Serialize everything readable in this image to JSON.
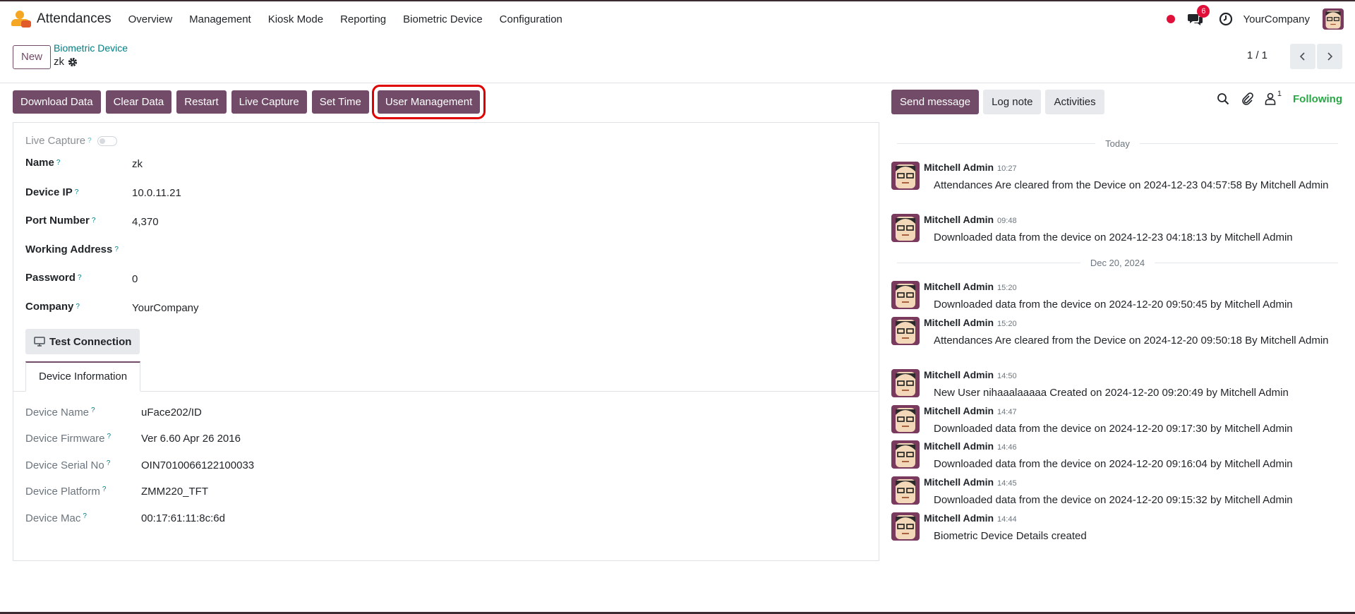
{
  "navbar": {
    "app_name": "Attendances",
    "menu": [
      "Overview",
      "Management",
      "Kiosk Mode",
      "Reporting",
      "Biometric Device",
      "Configuration"
    ],
    "chat_badge": "6",
    "company": "YourCompany"
  },
  "control_panel": {
    "new_label": "New",
    "breadcrumb": "Biometric Device",
    "record_name": "zk",
    "pager": "1 / 1"
  },
  "form_buttons": {
    "download": "Download Data",
    "clear": "Clear Data",
    "restart": "Restart",
    "live_capture": "Live Capture",
    "set_time": "Set Time",
    "user_management": "User Management"
  },
  "form": {
    "live_capture_label": "Live Capture",
    "live_capture_on": false,
    "fields": {
      "name": {
        "label": "Name",
        "value": "zk"
      },
      "device_ip": {
        "label": "Device IP",
        "value": "10.0.11.21"
      },
      "port": {
        "label": "Port Number",
        "value": "4,370"
      },
      "working_address": {
        "label": "Working Address",
        "value": ""
      },
      "password": {
        "label": "Password",
        "value": "0"
      },
      "company": {
        "label": "Company",
        "value": "YourCompany"
      }
    },
    "test_connection": "Test Connection",
    "tab_label": "Device Information",
    "info": {
      "device_name": {
        "label": "Device Name",
        "value": "uFace202/ID"
      },
      "firmware": {
        "label": "Device Firmware",
        "value": "Ver 6.60 Apr 26 2016"
      },
      "serial": {
        "label": "Device Serial No",
        "value": "OIN7010066122100033"
      },
      "platform": {
        "label": "Device Platform",
        "value": "ZMM220_TFT"
      },
      "mac": {
        "label": "Device Mac",
        "value": "00:17:61:11:8c:6d"
      }
    }
  },
  "chatter": {
    "send_message": "Send message",
    "log_note": "Log note",
    "activities": "Activities",
    "followers_count": "1",
    "following": "Following",
    "date_today": "Today",
    "date_dec20": "Dec 20, 2024",
    "messages": [
      {
        "author": "Mitchell Admin",
        "time": "10:27",
        "body": "Attendances Are cleared from the Device on 2024-12-23 04:57:58 By Mitchell Admin"
      },
      {
        "author": "Mitchell Admin",
        "time": "09:48",
        "body": "Downloaded data from the device on 2024-12-23 04:18:13 by Mitchell Admin"
      },
      {
        "author": "Mitchell Admin",
        "time": "15:20",
        "body": "Downloaded data from the device on 2024-12-20 09:50:45 by Mitchell Admin"
      },
      {
        "author": "Mitchell Admin",
        "time": "15:20",
        "body": "Attendances Are cleared from the Device on 2024-12-20 09:50:18 By Mitchell Admin"
      },
      {
        "author": "Mitchell Admin",
        "time": "14:50",
        "body": "New User nihaaalaaaaa Created on 2024-12-20 09:20:49 by Mitchell Admin"
      },
      {
        "author": "Mitchell Admin",
        "time": "14:47",
        "body": "Downloaded data from the device on 2024-12-20 09:17:30 by Mitchell Admin"
      },
      {
        "author": "Mitchell Admin",
        "time": "14:46",
        "body": "Downloaded data from the device on 2024-12-20 09:16:04 by Mitchell Admin"
      },
      {
        "author": "Mitchell Admin",
        "time": "14:45",
        "body": "Downloaded data from the device on 2024-12-20 09:15:32 by Mitchell Admin"
      },
      {
        "author": "Mitchell Admin",
        "time": "14:44",
        "body": "Biometric Device Details created"
      }
    ]
  },
  "colors": {
    "primary": "#714b67",
    "link": "#017e84",
    "success": "#28a745",
    "danger": "#e0103a",
    "highlight": "#e00000"
  }
}
